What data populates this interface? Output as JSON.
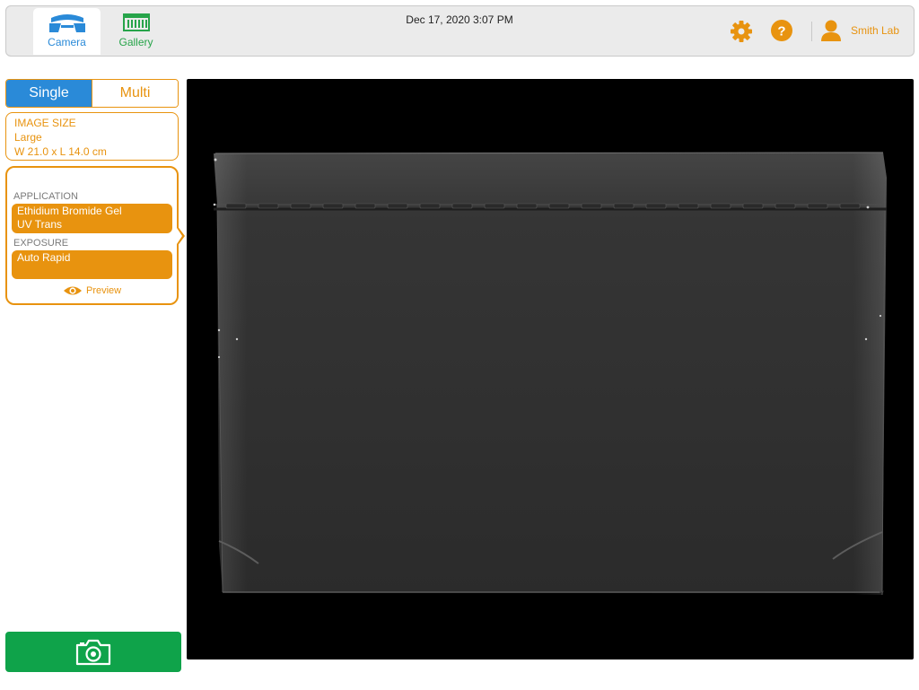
{
  "header": {
    "tabs": [
      {
        "label": "Camera",
        "icon": "camera-tab-icon",
        "active": true
      },
      {
        "label": "Gallery",
        "icon": "gallery-tab-icon",
        "active": false
      }
    ],
    "datetime": "Dec 17, 2020  3:07 PM",
    "user": "Smith Lab",
    "accent_color": "#e8930f"
  },
  "sidebar": {
    "modes": [
      "Single",
      "Multi"
    ],
    "selected_mode": "Single",
    "image_size": {
      "title": "IMAGE SIZE",
      "value": "Large",
      "dimensions": "W 21.0 x L 14.0 cm"
    },
    "application": {
      "label": "APPLICATION",
      "line1": "Ethidium Bromide Gel",
      "line2": "UV Trans"
    },
    "exposure": {
      "label": "EXPOSURE",
      "value": "Auto Rapid"
    },
    "preview_label": "Preview",
    "capture_color": "#0fa34a"
  }
}
